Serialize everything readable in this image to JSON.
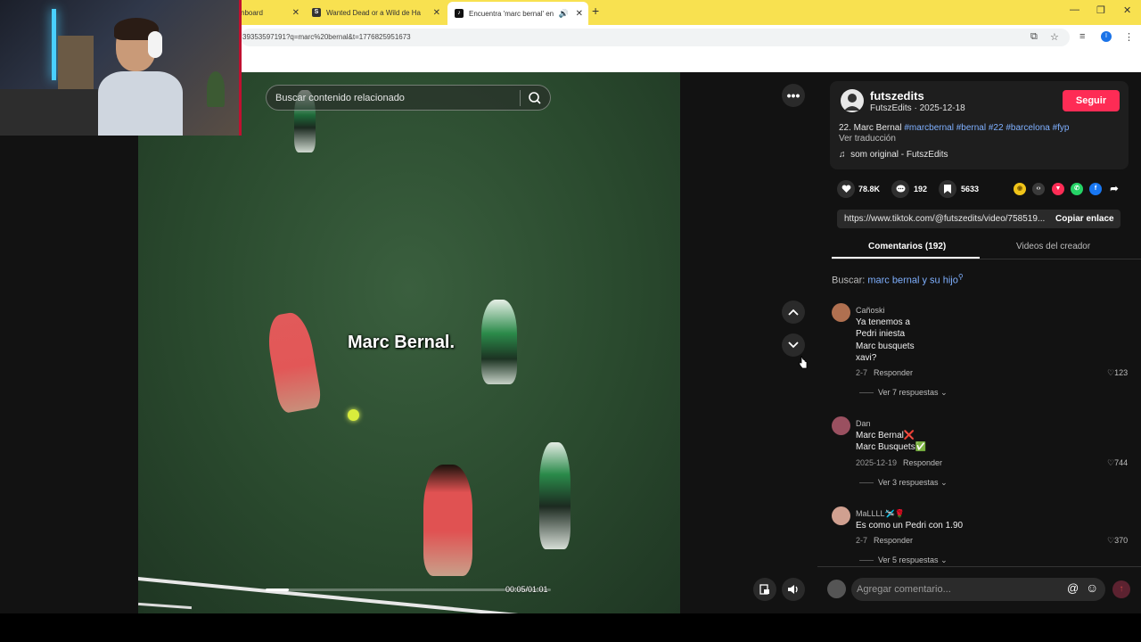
{
  "browser": {
    "tabs": [
      {
        "label": "nboard",
        "favicon": "dashboard"
      },
      {
        "label": "Wanted Dead or a Wild de Ha",
        "favicon": "S"
      },
      {
        "label": "Encuentra 'marc bernal' en",
        "favicon": "tiktok"
      }
    ],
    "url": "39353597191?q=marc%20bernal&t=1776825951673",
    "profile_initial": "I"
  },
  "video": {
    "search_placeholder": "Buscar contenido relacionado",
    "caption": "Marc Bernal.",
    "time": "00:05/01:01",
    "progress": 0.082
  },
  "author": {
    "username": "futszedits",
    "subline": "FutszEdits · 2025-12-18",
    "follow_label": "Seguir",
    "description_text": "22. Marc Bernal ",
    "hashtags": "#marcbernal #bernal #22 #barcelona #fyp",
    "translate": "Ver traducción",
    "sound": "som original - FutszEdits"
  },
  "stats": {
    "likes": "78.8K",
    "comments": "192",
    "saves": "5633"
  },
  "link": {
    "url": "https://www.tiktok.com/@futszedits/video/758519...",
    "copy_label": "Copiar enlace"
  },
  "tabs": {
    "comments": "Comentarios (192)",
    "creator_videos": "Videos del creador"
  },
  "related_search": {
    "prefix": "Buscar:",
    "query": "marc bernal y su hijo"
  },
  "comments": [
    {
      "user": "Cañoski",
      "lines": [
        "Ya tenemos a",
        "Pedri iniesta",
        "Marc busquets",
        "xavi?"
      ],
      "date": "2-7",
      "reply": "Responder",
      "likes": "123",
      "view_replies": "Ver 7 respuestas",
      "avatar_color": "#b07050"
    },
    {
      "user": "Dan",
      "lines": [
        "Marc Bernal❌",
        "Marc Busquets✅"
      ],
      "date": "2025-12-19",
      "reply": "Responder",
      "likes": "744",
      "view_replies": "Ver 3 respuestas",
      "avatar_color": "#9a5060"
    },
    {
      "user": "MaLLLL🛩️🌹",
      "lines": [
        "Es como un Pedri con 1.90"
      ],
      "date": "2-7",
      "reply": "Responder",
      "likes": "370",
      "view_replies": "Ver 5 respuestas",
      "avatar_color": "#d0a090"
    }
  ],
  "composer": {
    "placeholder": "Agregar comentario..."
  },
  "colors": {
    "accent": "#fe2c55",
    "hashtag": "#7fb0ff",
    "tabbar": "#f8e150"
  }
}
